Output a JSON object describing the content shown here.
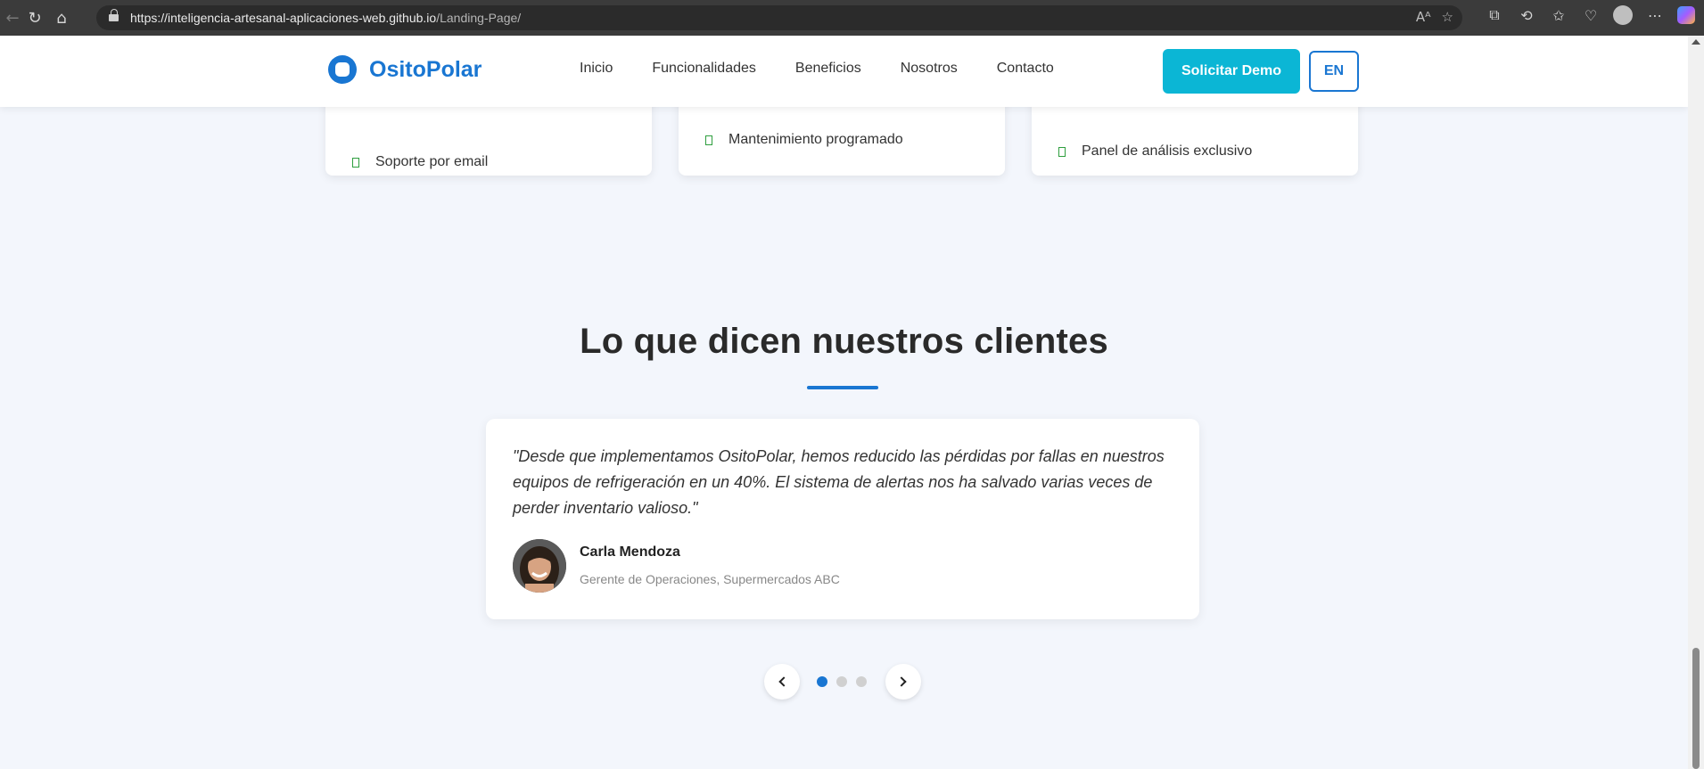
{
  "browser": {
    "url_host": "https://inteligencia-artesanal-aplicaciones-web.github.io",
    "url_path": "/Landing-Page/"
  },
  "header": {
    "logo_text": "OsitoPolar",
    "nav": [
      "Inicio",
      "Funcionalidades",
      "Beneficios",
      "Nosotros",
      "Contacto"
    ],
    "demo_button": "Solicitar Demo",
    "lang_button": "EN"
  },
  "plans": {
    "card1_feature": "Soporte por email",
    "card2_feature": "Mantenimiento programado",
    "card3_feature": "Panel de análisis exclusivo"
  },
  "testimonials": {
    "title": "Lo que dicen nuestros clientes",
    "quote": "\"Desde que implementamos OsitoPolar, hemos reducido las pérdidas por fallas en nuestros equipos de refrigeración en un 40%. El sistema de alertas nos ha salvado varias veces de perder inventario valioso.\"",
    "name": "Carla Mendoza",
    "role": "Gerente de Operaciones, Supermercados ABC",
    "active_slide": 1,
    "slide_count": 3
  },
  "colors": {
    "brand": "#1976d2",
    "demo_button": "#0bb6d5",
    "page_bg": "#f3f6fc",
    "check": "#2e9e3e"
  }
}
